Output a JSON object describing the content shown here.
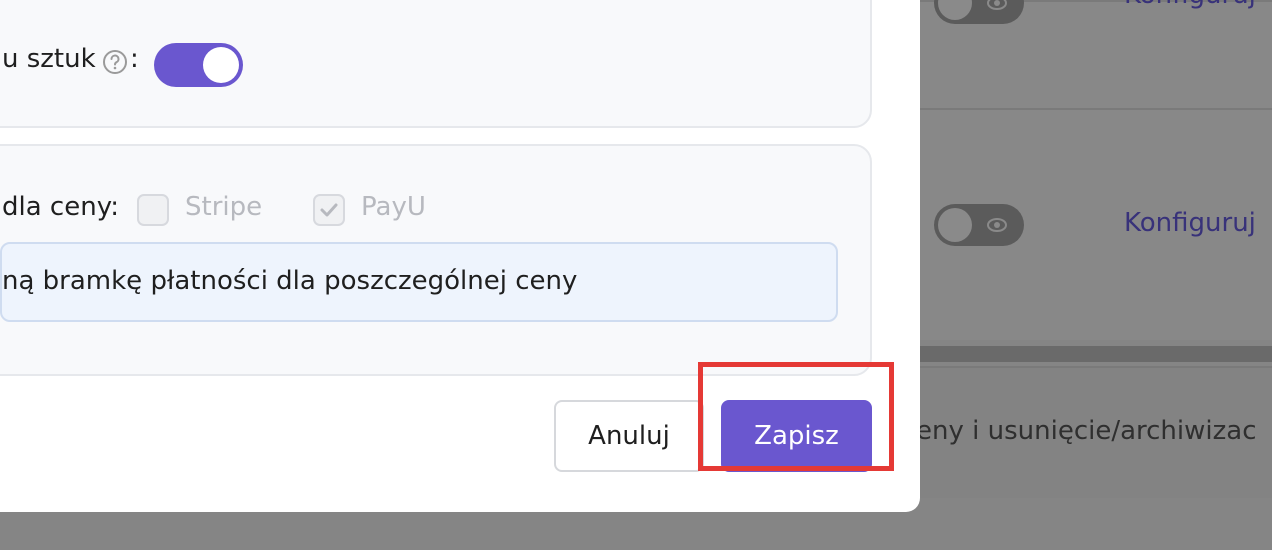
{
  "background": {
    "top_link": "Konfiguruj",
    "mid_link": "Konfiguruj",
    "bottom_text": "eny i usunięcie/archiwizac"
  },
  "modal": {
    "quantity_section": {
      "label": "u sztuk",
      "colon": ":",
      "toggle_on": true
    },
    "payment_section": {
      "label": "dla ceny:",
      "options": [
        {
          "label": "Stripe",
          "checked": false
        },
        {
          "label": "PayU",
          "checked": true
        }
      ],
      "info": "ną bramkę płatności dla poszczególnej ceny"
    },
    "buttons": {
      "cancel": "Anuluj",
      "save": "Zapisz"
    }
  },
  "colors": {
    "accent": "#6a57cf",
    "highlight": "#e53935"
  }
}
